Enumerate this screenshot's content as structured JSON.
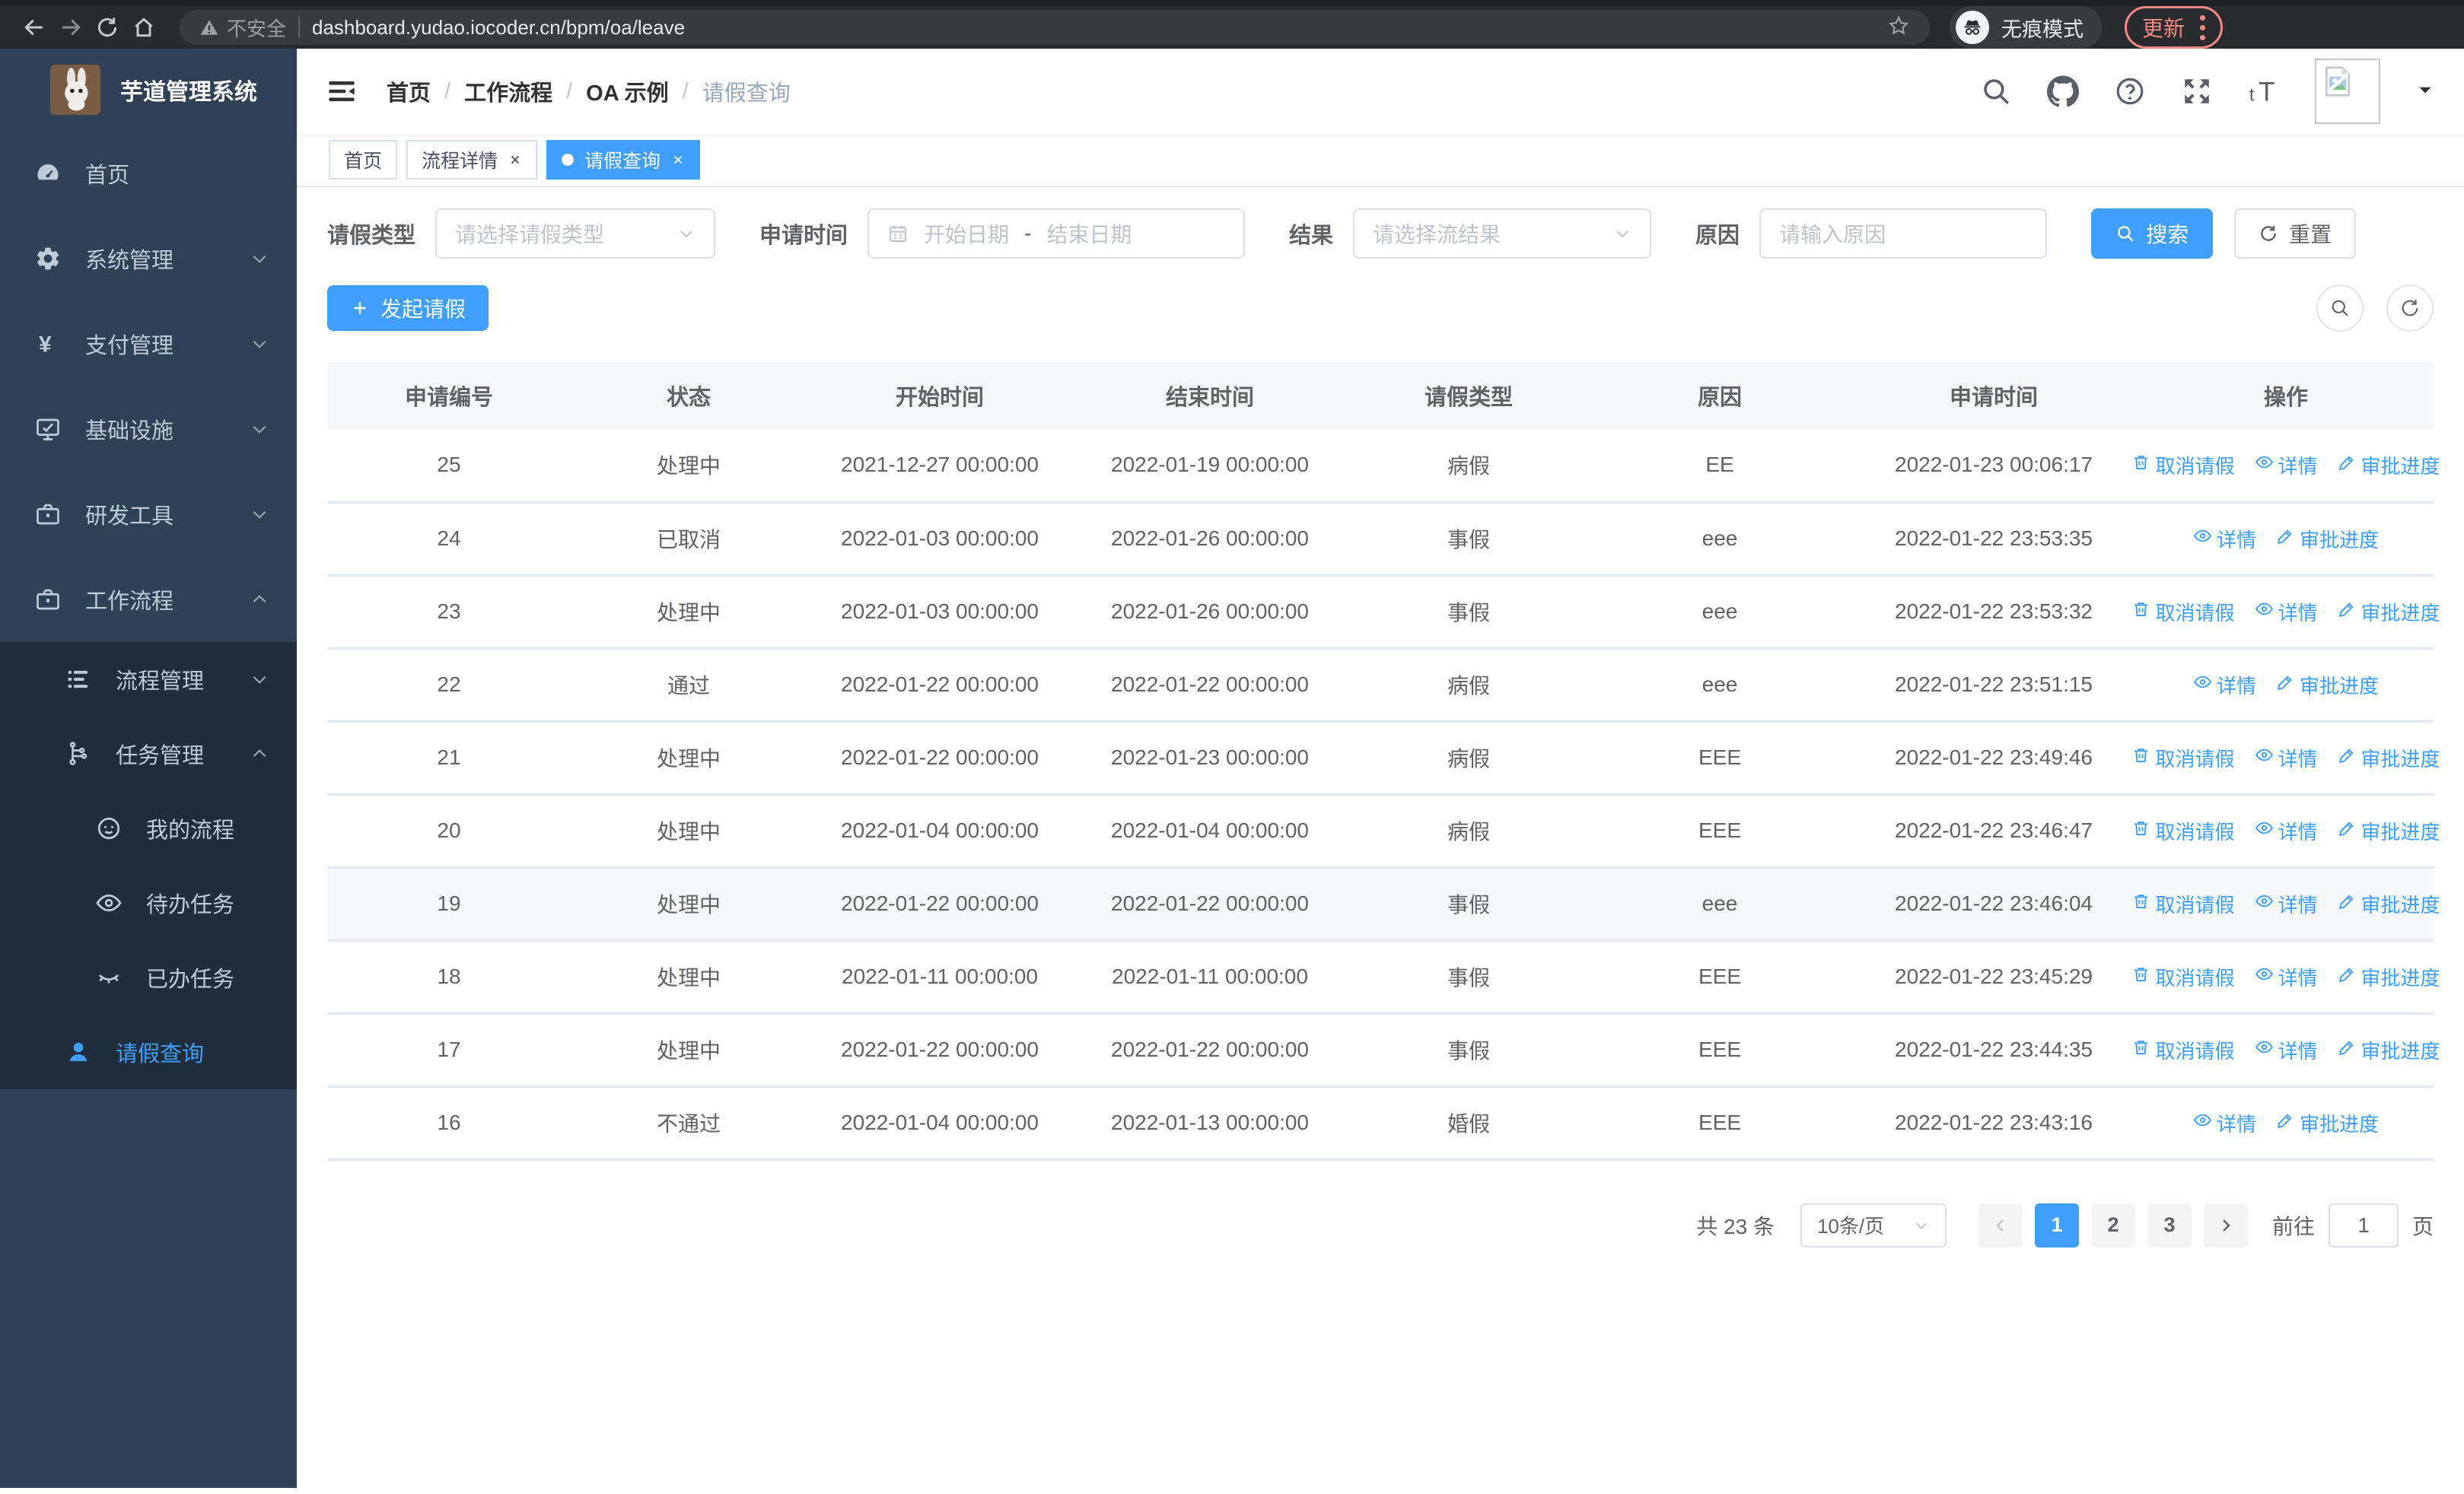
{
  "browser": {
    "security_label": "不安全",
    "url": "dashboard.yudao.iocoder.cn/bpm/oa/leave",
    "incognito_label": "无痕模式",
    "update_label": "更新"
  },
  "sidebar": {
    "brand": "芋道管理系统",
    "menu": [
      {
        "label": "首页",
        "icon": "dashboard-icon",
        "level": 1,
        "chevron": null,
        "sub": false,
        "active": false
      },
      {
        "label": "系统管理",
        "icon": "gear-icon",
        "level": 1,
        "chevron": "down",
        "sub": false,
        "active": false
      },
      {
        "label": "支付管理",
        "icon": "yen-icon",
        "level": 1,
        "chevron": "down",
        "sub": false,
        "active": false
      },
      {
        "label": "基础设施",
        "icon": "monitor-icon",
        "level": 1,
        "chevron": "down",
        "sub": false,
        "active": false
      },
      {
        "label": "研发工具",
        "icon": "briefcase-icon",
        "level": 1,
        "chevron": "down",
        "sub": false,
        "active": false
      },
      {
        "label": "工作流程",
        "icon": "briefcase-icon",
        "level": 1,
        "chevron": "up",
        "sub": false,
        "active": false
      },
      {
        "label": "流程管理",
        "icon": "process-list-icon",
        "level": 2,
        "chevron": "down",
        "sub": true,
        "active": false
      },
      {
        "label": "任务管理",
        "icon": "task-tree-icon",
        "level": 2,
        "chevron": "up",
        "sub": true,
        "active": false
      },
      {
        "label": "我的流程",
        "icon": "face-icon",
        "level": 3,
        "chevron": null,
        "sub": true,
        "active": false
      },
      {
        "label": "待办任务",
        "icon": "eye-open-icon",
        "level": 3,
        "chevron": null,
        "sub": true,
        "active": false
      },
      {
        "label": "已办任务",
        "icon": "eye-closed-icon",
        "level": 3,
        "chevron": null,
        "sub": true,
        "active": false
      },
      {
        "label": "请假查询",
        "icon": "user-icon",
        "level": 2,
        "chevron": null,
        "sub": true,
        "active": true
      }
    ]
  },
  "header": {
    "breadcrumb": [
      "首页",
      "工作流程",
      "OA 示例",
      "请假查询"
    ]
  },
  "tabs": [
    {
      "label": "首页",
      "closable": false,
      "active": false
    },
    {
      "label": "流程详情",
      "closable": true,
      "active": false
    },
    {
      "label": "请假查询",
      "closable": true,
      "active": true
    }
  ],
  "filters": {
    "leave_type": {
      "label": "请假类型",
      "placeholder": "请选择请假类型"
    },
    "apply_time": {
      "label": "申请时间",
      "start_placeholder": "开始日期",
      "separator": "-",
      "end_placeholder": "结束日期"
    },
    "result": {
      "label": "结果",
      "placeholder": "请选择流结果"
    },
    "reason": {
      "label": "原因",
      "placeholder": "请输入原因"
    },
    "search_label": "搜索",
    "reset_label": "重置"
  },
  "toolbar": {
    "create_label": "发起请假"
  },
  "table": {
    "columns": [
      "申请编号",
      "状态",
      "开始时间",
      "结束时间",
      "请假类型",
      "原因",
      "申请时间",
      "操作"
    ],
    "action_labels": {
      "cancel": "取消请假",
      "detail": "详情",
      "progress": "审批进度"
    },
    "rows": [
      {
        "id": "25",
        "status": "处理中",
        "start": "2021-12-27 00:00:00",
        "end": "2022-01-19 00:00:00",
        "type": "病假",
        "reason": "EE",
        "applied": "2022-01-23 00:06:17",
        "actions": [
          "cancel",
          "detail",
          "progress"
        ],
        "highlight": false
      },
      {
        "id": "24",
        "status": "已取消",
        "start": "2022-01-03 00:00:00",
        "end": "2022-01-26 00:00:00",
        "type": "事假",
        "reason": "eee",
        "applied": "2022-01-22 23:53:35",
        "actions": [
          "detail",
          "progress"
        ],
        "highlight": false
      },
      {
        "id": "23",
        "status": "处理中",
        "start": "2022-01-03 00:00:00",
        "end": "2022-01-26 00:00:00",
        "type": "事假",
        "reason": "eee",
        "applied": "2022-01-22 23:53:32",
        "actions": [
          "cancel",
          "detail",
          "progress"
        ],
        "highlight": false
      },
      {
        "id": "22",
        "status": "通过",
        "start": "2022-01-22 00:00:00",
        "end": "2022-01-22 00:00:00",
        "type": "病假",
        "reason": "eee",
        "applied": "2022-01-22 23:51:15",
        "actions": [
          "detail",
          "progress"
        ],
        "highlight": false
      },
      {
        "id": "21",
        "status": "处理中",
        "start": "2022-01-22 00:00:00",
        "end": "2022-01-23 00:00:00",
        "type": "病假",
        "reason": "EEE",
        "applied": "2022-01-22 23:49:46",
        "actions": [
          "cancel",
          "detail",
          "progress"
        ],
        "highlight": false
      },
      {
        "id": "20",
        "status": "处理中",
        "start": "2022-01-04 00:00:00",
        "end": "2022-01-04 00:00:00",
        "type": "病假",
        "reason": "EEE",
        "applied": "2022-01-22 23:46:47",
        "actions": [
          "cancel",
          "detail",
          "progress"
        ],
        "highlight": false
      },
      {
        "id": "19",
        "status": "处理中",
        "start": "2022-01-22 00:00:00",
        "end": "2022-01-22 00:00:00",
        "type": "事假",
        "reason": "eee",
        "applied": "2022-01-22 23:46:04",
        "actions": [
          "cancel",
          "detail",
          "progress"
        ],
        "highlight": true
      },
      {
        "id": "18",
        "status": "处理中",
        "start": "2022-01-11 00:00:00",
        "end": "2022-01-11 00:00:00",
        "type": "事假",
        "reason": "EEE",
        "applied": "2022-01-22 23:45:29",
        "actions": [
          "cancel",
          "detail",
          "progress"
        ],
        "highlight": false
      },
      {
        "id": "17",
        "status": "处理中",
        "start": "2022-01-22 00:00:00",
        "end": "2022-01-22 00:00:00",
        "type": "事假",
        "reason": "EEE",
        "applied": "2022-01-22 23:44:35",
        "actions": [
          "cancel",
          "detail",
          "progress"
        ],
        "highlight": false
      },
      {
        "id": "16",
        "status": "不通过",
        "start": "2022-01-04 00:00:00",
        "end": "2022-01-13 00:00:00",
        "type": "婚假",
        "reason": "EEE",
        "applied": "2022-01-22 23:43:16",
        "actions": [
          "detail",
          "progress"
        ],
        "highlight": false
      }
    ]
  },
  "pagination": {
    "total_label": "共 23 条",
    "page_size": "10条/页",
    "pages": [
      "1",
      "2",
      "3"
    ],
    "active_page": "1",
    "goto_label": "前往",
    "goto_value": "1",
    "page_unit": "页"
  },
  "colors": {
    "primary": "#409eff",
    "sidebar_bg": "#304156",
    "submenu_bg": "#1f2d3d"
  }
}
